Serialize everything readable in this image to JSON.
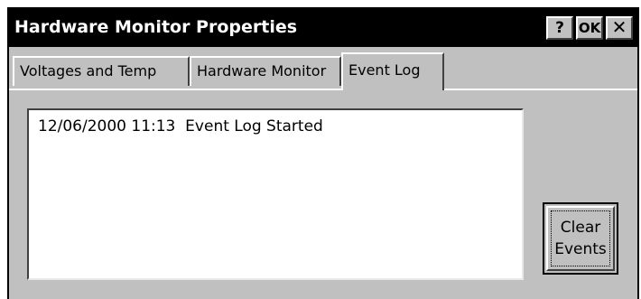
{
  "window": {
    "title": "Hardware Monitor Properties",
    "help_label": "?",
    "ok_label": "OK",
    "close_label": "✕"
  },
  "tabs": [
    {
      "label": "Voltages and Temp",
      "selected": false
    },
    {
      "label": "Hardware Monitor",
      "selected": false
    },
    {
      "label": "Event Log",
      "selected": true
    }
  ],
  "event_log": {
    "entries": [
      {
        "text": "12/06/2000 11:13  Event Log Started"
      }
    ]
  },
  "clear_button": {
    "line1": "Clear",
    "line2": "Events"
  },
  "colors": {
    "titlebar": "#000000",
    "face": "#c0c0c0",
    "list_background": "#ffffff"
  }
}
